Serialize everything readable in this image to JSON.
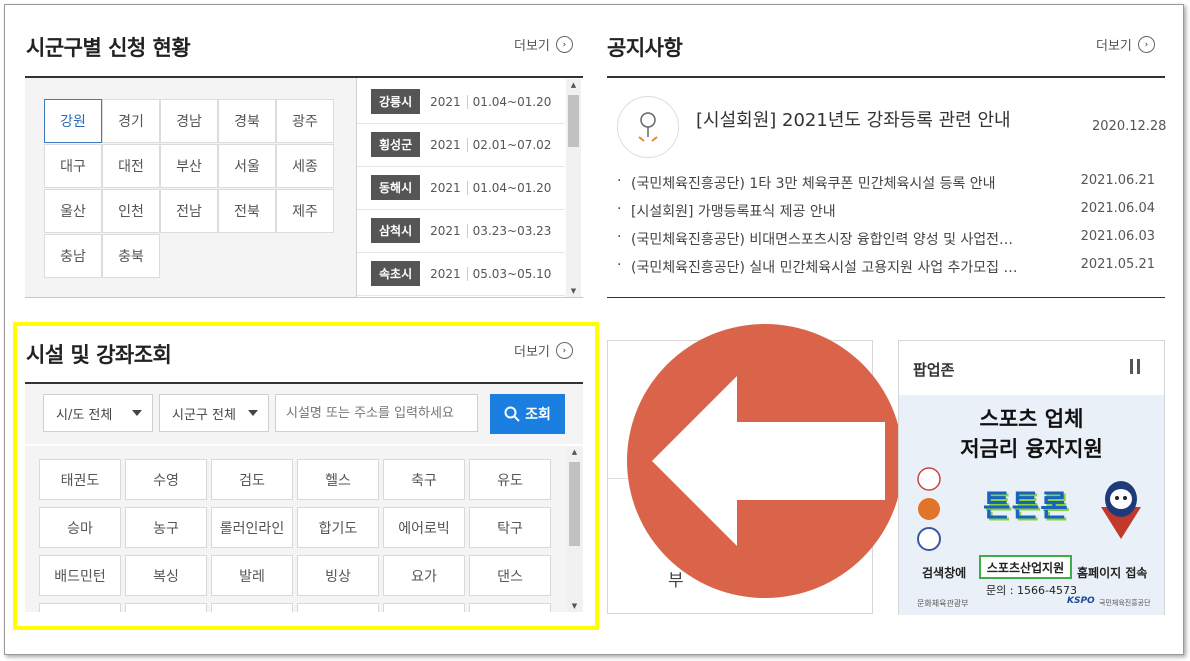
{
  "region_section": {
    "title": "시군구별 신청 현황",
    "more_label": "더보기",
    "regions": [
      "강원",
      "경기",
      "경남",
      "경북",
      "광주",
      "대구",
      "대전",
      "부산",
      "서울",
      "세종",
      "울산",
      "인천",
      "전남",
      "전북",
      "제주",
      "충남",
      "충북"
    ],
    "selected": "강원",
    "schedule": [
      {
        "city": "강릉시",
        "year": "2021",
        "dates": "01.04~01.20"
      },
      {
        "city": "횡성군",
        "year": "2021",
        "dates": "02.01~07.02"
      },
      {
        "city": "동해시",
        "year": "2021",
        "dates": "01.04~01.20"
      },
      {
        "city": "삼척시",
        "year": "2021",
        "dates": "03.23~03.23"
      },
      {
        "city": "속초시",
        "year": "2021",
        "dates": "05.03~05.10"
      }
    ]
  },
  "notice_section": {
    "title": "공지사항",
    "more_label": "더보기",
    "featured": {
      "title": "[시설회원] 2021년도 강좌등록 관련 안내",
      "date": "2020.12.28",
      "icon": "lamp-icon"
    },
    "items": [
      {
        "title": "(국민체육진흥공단) 1타 3만 체육쿠폰 민간체육시설 등록 안내",
        "date": "2021.06.21"
      },
      {
        "title": "[시설회원] 가맹등록표식 제공 안내",
        "date": "2021.06.04"
      },
      {
        "title": "(국민체육진흥공단) 비대면스포츠시장 융합인력 양성 및 사업전…",
        "date": "2021.06.03"
      },
      {
        "title": "(국민체육진흥공단) 실내 민간체육시설 고용지원 사업 추가모집 …",
        "date": "2021.05.21"
      }
    ]
  },
  "facility_section": {
    "title": "시설 및 강좌조회",
    "more_label": "더보기",
    "province_select": "시/도 전체",
    "district_select": "시군구 전체",
    "search_placeholder": "시설명 또는 주소를 입력하세요",
    "search_button": "조회",
    "sports": [
      "태권도",
      "수영",
      "검도",
      "헬스",
      "축구",
      "유도",
      "승마",
      "농구",
      "롤러인라인",
      "합기도",
      "에어로빅",
      "탁구",
      "배드민턴",
      "복싱",
      "발레",
      "빙상",
      "요가",
      "댄스"
    ]
  },
  "highlight_color": "#ffff00",
  "overlay": {
    "icon": "back-arrow-icon",
    "color": "#d9644a"
  },
  "partial_text": "부",
  "popup": {
    "title": "팝업존",
    "pause_icon": "pause-icon",
    "headline1": "스포츠 업체",
    "headline2": "저금리 융자지원",
    "brand": "튼튼론",
    "search_prefix": "검색창에",
    "search_term": "스포츠산업지원",
    "search_suffix": "홈페이지 접속",
    "contact": "문의 : 1566-4573",
    "org_left": "문화체육관광부",
    "org_right_brand": "KSPO",
    "org_right": "국민체육진흥공단"
  }
}
